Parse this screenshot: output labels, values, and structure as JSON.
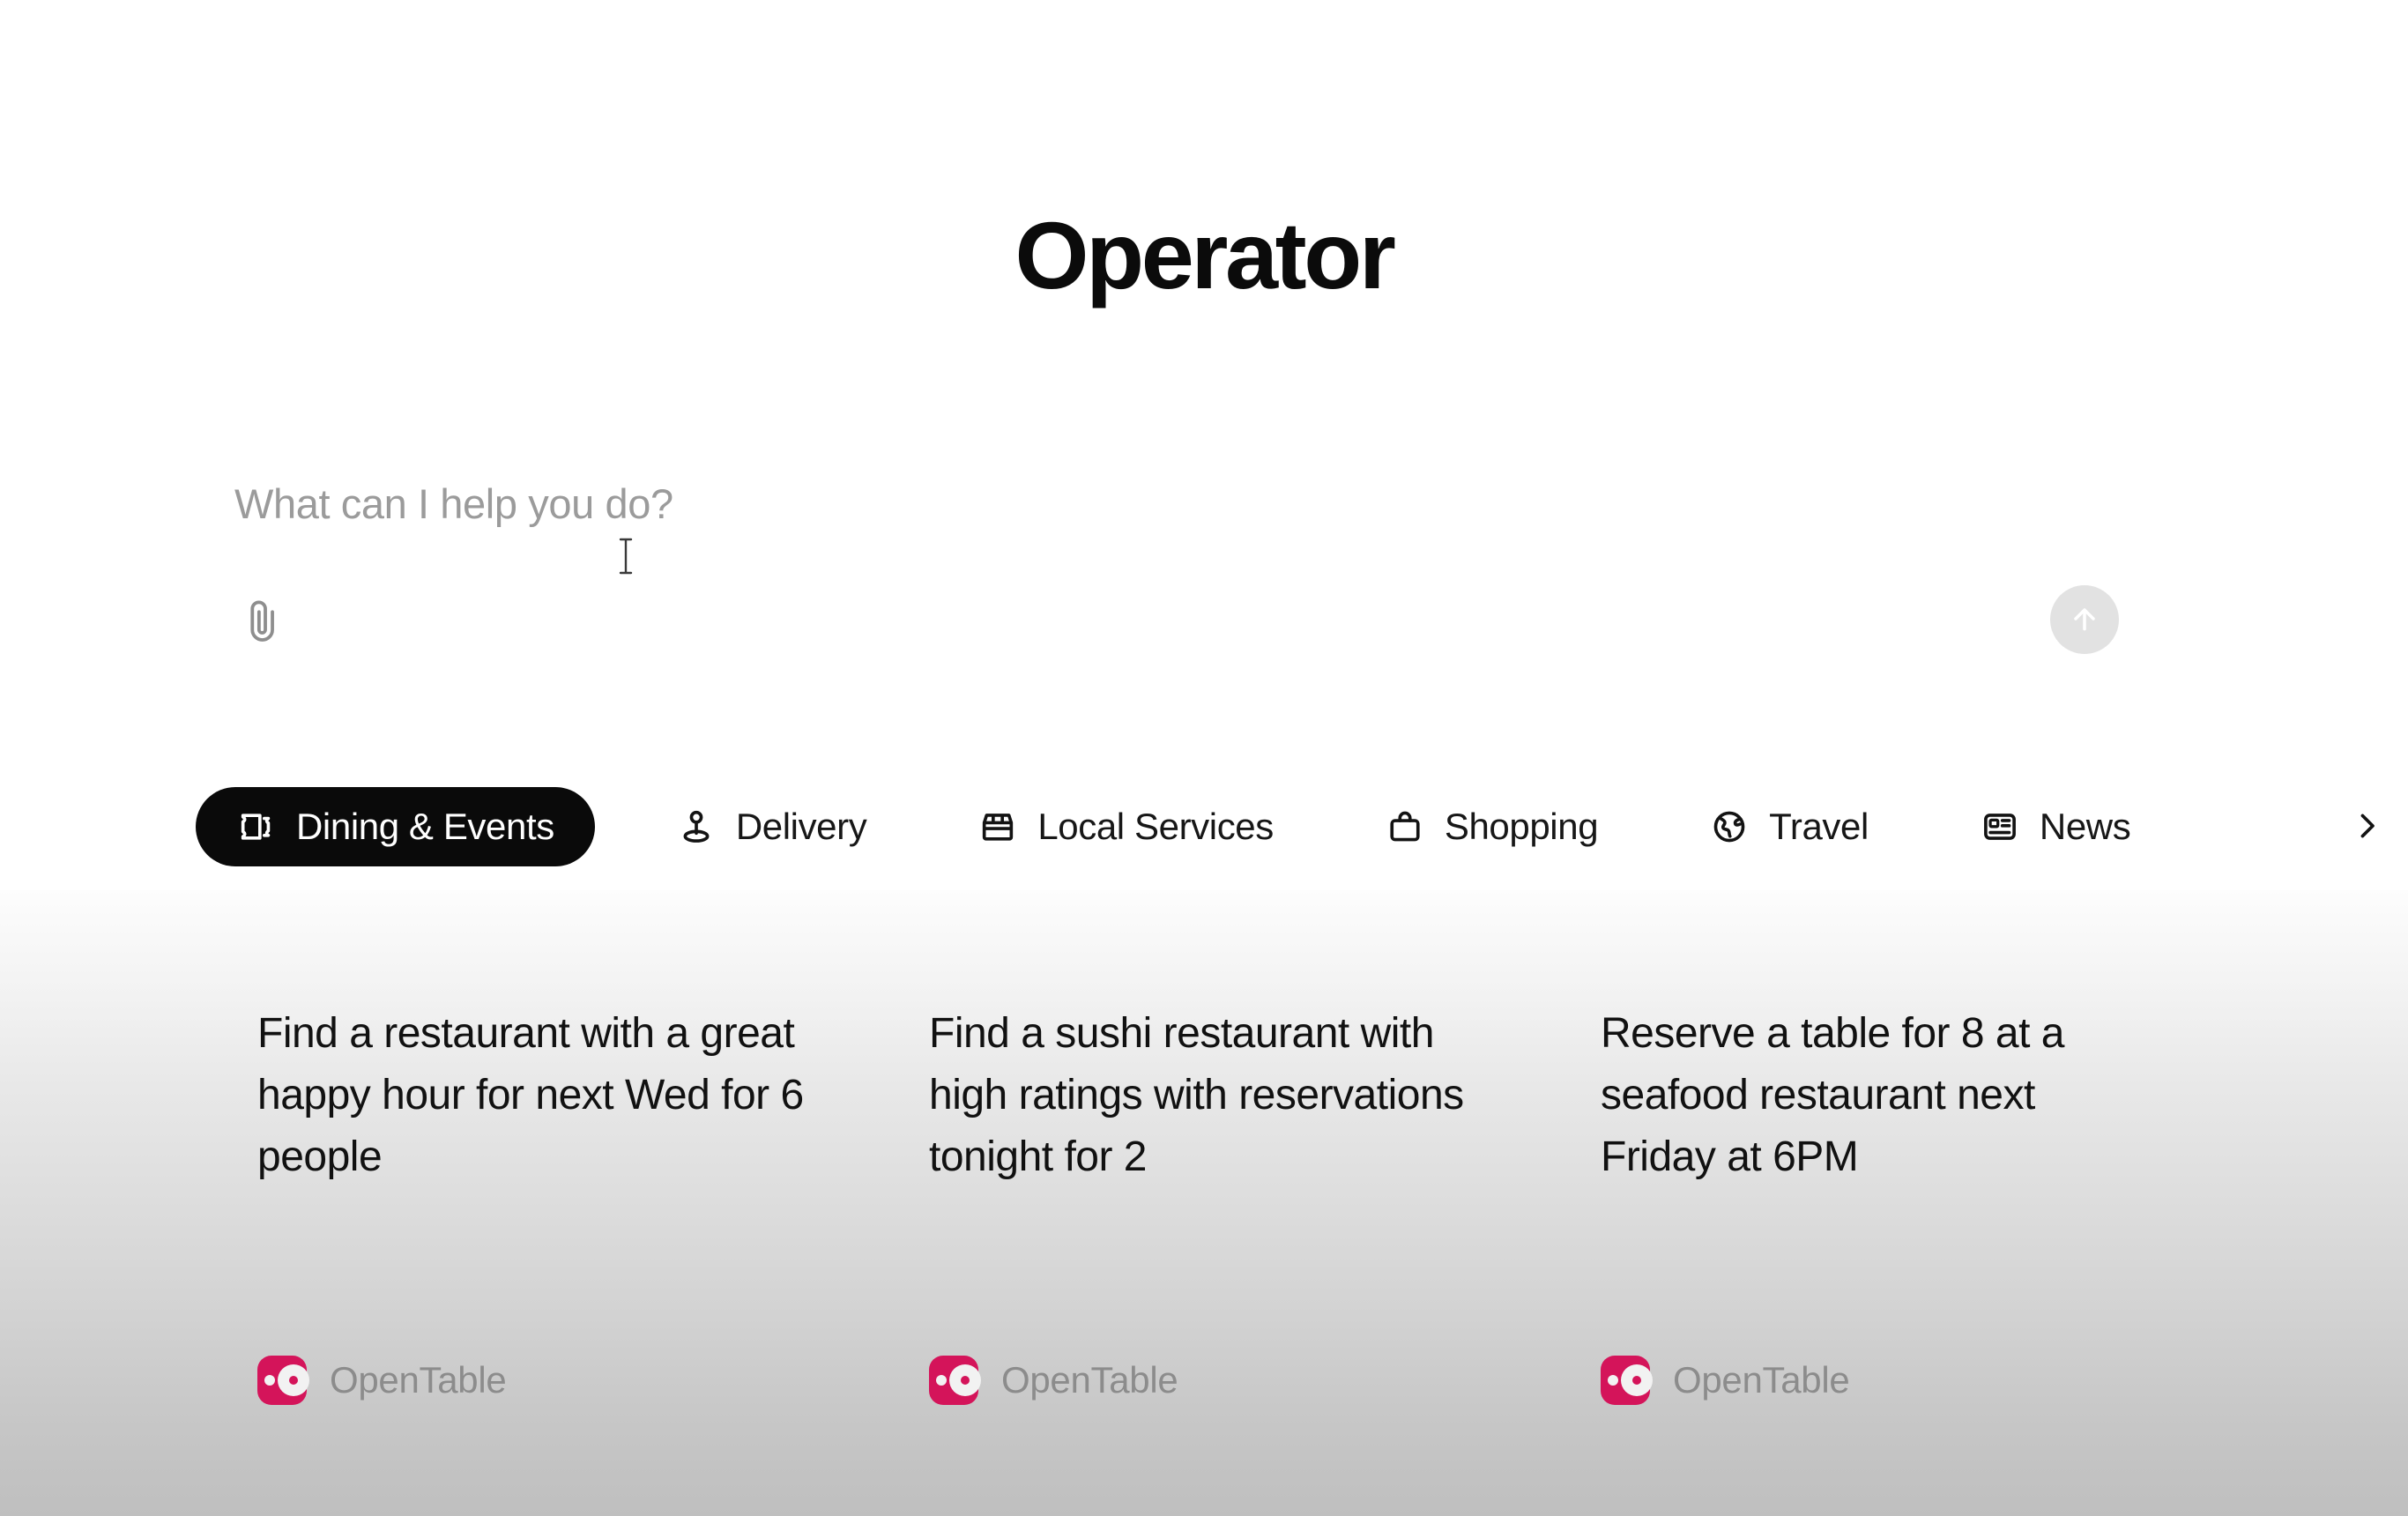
{
  "app": {
    "title": "Operator"
  },
  "composer": {
    "placeholder": "What can I help you do?",
    "value": "",
    "attach_icon": "paperclip-icon",
    "send_icon": "arrow-up-icon",
    "cursor_icon": "text-cursor"
  },
  "tabs": {
    "next_icon": "chevron-right-icon",
    "items": [
      {
        "label": "Dining & Events",
        "icon": "ticket-icon",
        "active": true
      },
      {
        "label": "Delivery",
        "icon": "map-pin-icon",
        "active": false
      },
      {
        "label": "Local Services",
        "icon": "storefront-icon",
        "active": false
      },
      {
        "label": "Shopping",
        "icon": "shopping-bag-icon",
        "active": false
      },
      {
        "label": "Travel",
        "icon": "globe-icon",
        "active": false
      },
      {
        "label": "News",
        "icon": "news-icon",
        "active": false
      }
    ]
  },
  "suggestions": [
    {
      "text": "Find a restaurant with a great happy hour for next Wed for 6 people",
      "source": "OpenTable",
      "source_logo": "opentable-logo"
    },
    {
      "text": "Find a sushi restaurant with high ratings with reservations tonight for 2",
      "source": "OpenTable",
      "source_logo": "opentable-logo"
    },
    {
      "text": "Reserve a table for 8 at a seafood restaurant next Friday at 6PM",
      "source": "OpenTable",
      "source_logo": "opentable-logo"
    }
  ],
  "colors": {
    "accent_active_tab": "#0a0a0a",
    "text_primary": "#111111",
    "text_muted": "#9b9b9b",
    "source_brand": "#d4145a",
    "send_button_bg": "#e2e2e2"
  }
}
